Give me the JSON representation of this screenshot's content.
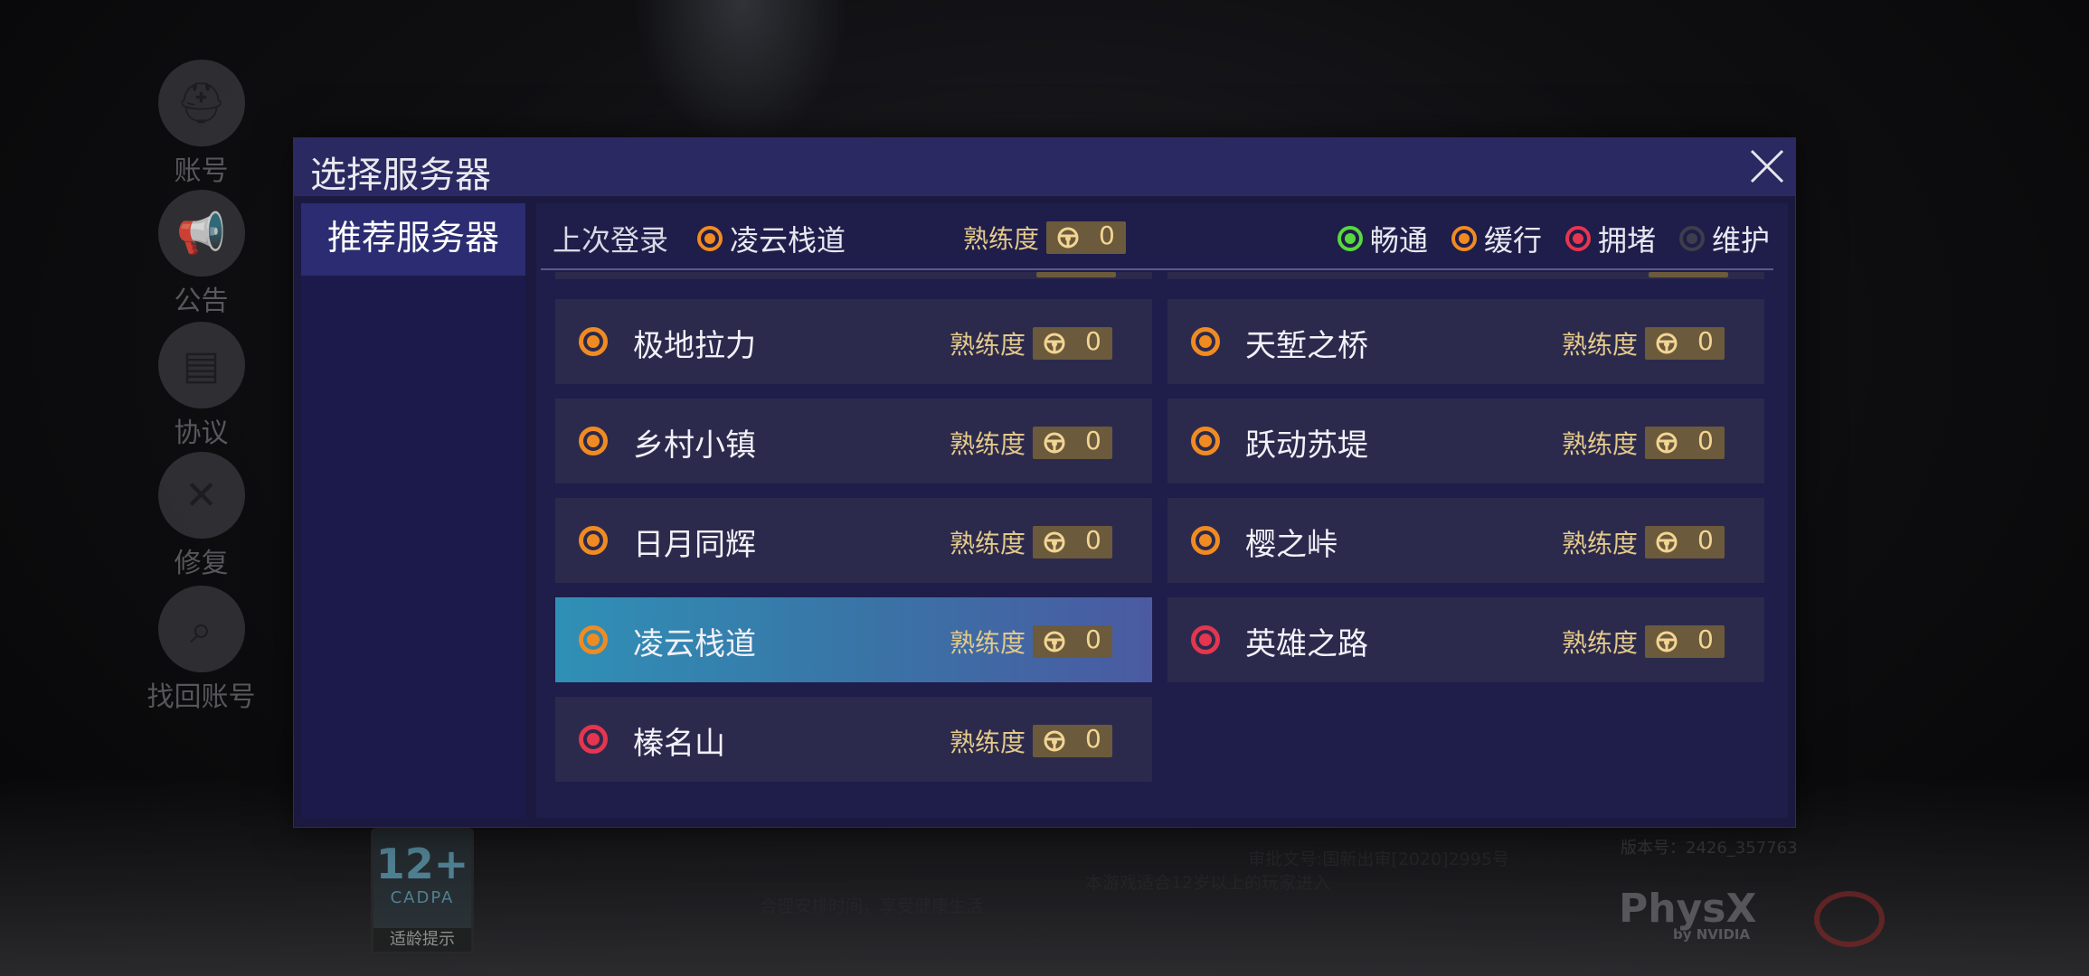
{
  "background": {
    "side_menu": [
      {
        "label": "账号",
        "icon": "helmet-icon"
      },
      {
        "label": "公告",
        "icon": "megaphone-icon"
      },
      {
        "label": "协议",
        "icon": "document-icon"
      },
      {
        "label": "修复",
        "icon": "wrench-icon"
      },
      {
        "label": "找回账号",
        "icon": "search-helmet-icon"
      }
    ],
    "age_rating": {
      "number": "12+",
      "org": "CADPA",
      "tip": "适龄提示"
    },
    "legal_lines": [
      "审批文号:国新出审[2020]2995号",
      "本游戏适合12岁以上的玩家进入",
      "合理安排时间，享受健康生活"
    ],
    "version": "版本号：2426_357763",
    "physx": {
      "brand": "PhysX",
      "by": "by NVIDIA"
    }
  },
  "dialog": {
    "title": "选择服务器",
    "close_icon": "close-icon",
    "tabs": [
      {
        "label": "推荐服务器",
        "active": true
      }
    ],
    "last_login": {
      "label": "上次登录",
      "server": "凌云栈道",
      "status": "orange",
      "proficiency_label": "熟练度",
      "proficiency_value": "0"
    },
    "legend": [
      {
        "label": "畅通",
        "status": "green",
        "color": "#58d83d"
      },
      {
        "label": "缓行",
        "status": "orange",
        "color": "#f08b22"
      },
      {
        "label": "拥堵",
        "status": "red",
        "color": "#e5354f"
      },
      {
        "label": "维护",
        "status": "gray",
        "color": "#3e3e4a"
      }
    ],
    "servers": [
      {
        "name": "极地拉力",
        "status": "orange",
        "proficiency_label": "熟练度",
        "proficiency_value": "0",
        "selected": false
      },
      {
        "name": "天堑之桥",
        "status": "orange",
        "proficiency_label": "熟练度",
        "proficiency_value": "0",
        "selected": false
      },
      {
        "name": "乡村小镇",
        "status": "orange",
        "proficiency_label": "熟练度",
        "proficiency_value": "0",
        "selected": false
      },
      {
        "name": "跃动苏堤",
        "status": "orange",
        "proficiency_label": "熟练度",
        "proficiency_value": "0",
        "selected": false
      },
      {
        "name": "日月同辉",
        "status": "orange",
        "proficiency_label": "熟练度",
        "proficiency_value": "0",
        "selected": false
      },
      {
        "name": "樱之峠",
        "status": "orange",
        "proficiency_label": "熟练度",
        "proficiency_value": "0",
        "selected": false
      },
      {
        "name": "凌云栈道",
        "status": "orange",
        "proficiency_label": "熟练度",
        "proficiency_value": "0",
        "selected": true
      },
      {
        "name": "英雄之路",
        "status": "red",
        "proficiency_label": "熟练度",
        "proficiency_value": "0",
        "selected": false
      },
      {
        "name": "榛名山",
        "status": "red",
        "proficiency_label": "熟练度",
        "proficiency_value": "0",
        "selected": false
      }
    ],
    "colors": {
      "accent_selected": "#2f90b6",
      "gold": "#e3c98a",
      "panel": "#1b1940"
    }
  }
}
